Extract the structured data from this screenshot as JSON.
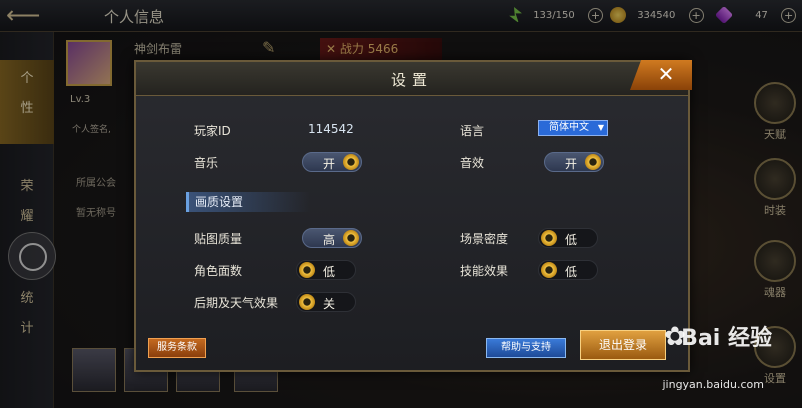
{
  "header": {
    "back_icon": "back-arrow-icon",
    "title": "个人信息",
    "resources": [
      {
        "icon": "stamina-icon",
        "value": "133/150",
        "color": "#7ac84a"
      },
      {
        "icon": "gold-coin-icon",
        "value": "334540",
        "color": "#e0b030"
      },
      {
        "icon": "gem-icon",
        "value": "47",
        "color": "#b050e0"
      }
    ]
  },
  "left_tabs": {
    "personality": "个\n性",
    "honor": "荣\n耀",
    "stats": "统\n计"
  },
  "profile": {
    "name": "神剑布雷",
    "power_label": "战力",
    "power_value": "5466",
    "level": "Lv.3",
    "signature": "个人签名,",
    "guild": "所属公会",
    "title": "暂无称号"
  },
  "right_menu": {
    "talent": "天赋",
    "fashion": "时装",
    "soul": "魂器",
    "settings": "设置"
  },
  "dialog": {
    "title": "设置",
    "player_id_label": "玩家ID",
    "player_id": "114542",
    "language_label": "语言",
    "language_value": "简体中文",
    "music_label": "音乐",
    "music_value": "开",
    "sfx_label": "音效",
    "sfx_value": "开",
    "quality_section": "画质设置",
    "texture_label": "贴图质量",
    "texture_value": "高",
    "scene_density_label": "场景密度",
    "scene_density_value": "低",
    "char_faces_label": "角色面数",
    "char_faces_value": "低",
    "skill_effects_label": "技能效果",
    "skill_effects_value": "低",
    "post_weather_label": "后期及天气效果",
    "post_weather_value": "关",
    "terms_button": "服务条款",
    "help_button": "帮助与支持",
    "logout_button": "退出登录"
  },
  "watermark": {
    "brand": "Bai 经验",
    "url": "jingyan.baidu.com"
  }
}
